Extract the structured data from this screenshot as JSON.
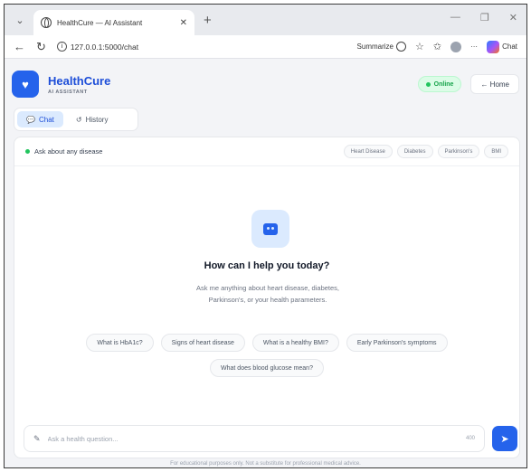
{
  "browser": {
    "tab_title": "HealthCure — AI Assistant",
    "url": "127.0.0.1:5000/chat",
    "summarize_label": "Summarize",
    "chat_label": "Chat"
  },
  "header": {
    "brand_name": "HealthCure",
    "brand_sub": "AI ASSISTANT",
    "status": "Online",
    "home_label": "← Home"
  },
  "tabs": [
    {
      "label": "Chat"
    },
    {
      "label": "History"
    }
  ],
  "chat": {
    "ask_label": "Ask about any disease",
    "topic_chips": [
      "Heart Disease",
      "Diabetes",
      "Parkinson's",
      "BMI"
    ],
    "welcome_title": "How can I help you today?",
    "welcome_sub": "Ask me anything about heart disease, diabetes, Parkinson's, or your health parameters.",
    "suggestions_row1": [
      "What is HbA1c?",
      "Signs of heart disease",
      "What is a healthy BMI?",
      "Early Parkinson's symptoms"
    ],
    "suggestions_row2": [
      "What does blood glucose mean?"
    ],
    "input_placeholder": "Ask a health question...",
    "char_count": "400"
  },
  "footer_text": "For educational purposes only. Not a substitute for professional medical advice.",
  "colors": {
    "accent": "#2563eb",
    "online": "#16a34a"
  }
}
